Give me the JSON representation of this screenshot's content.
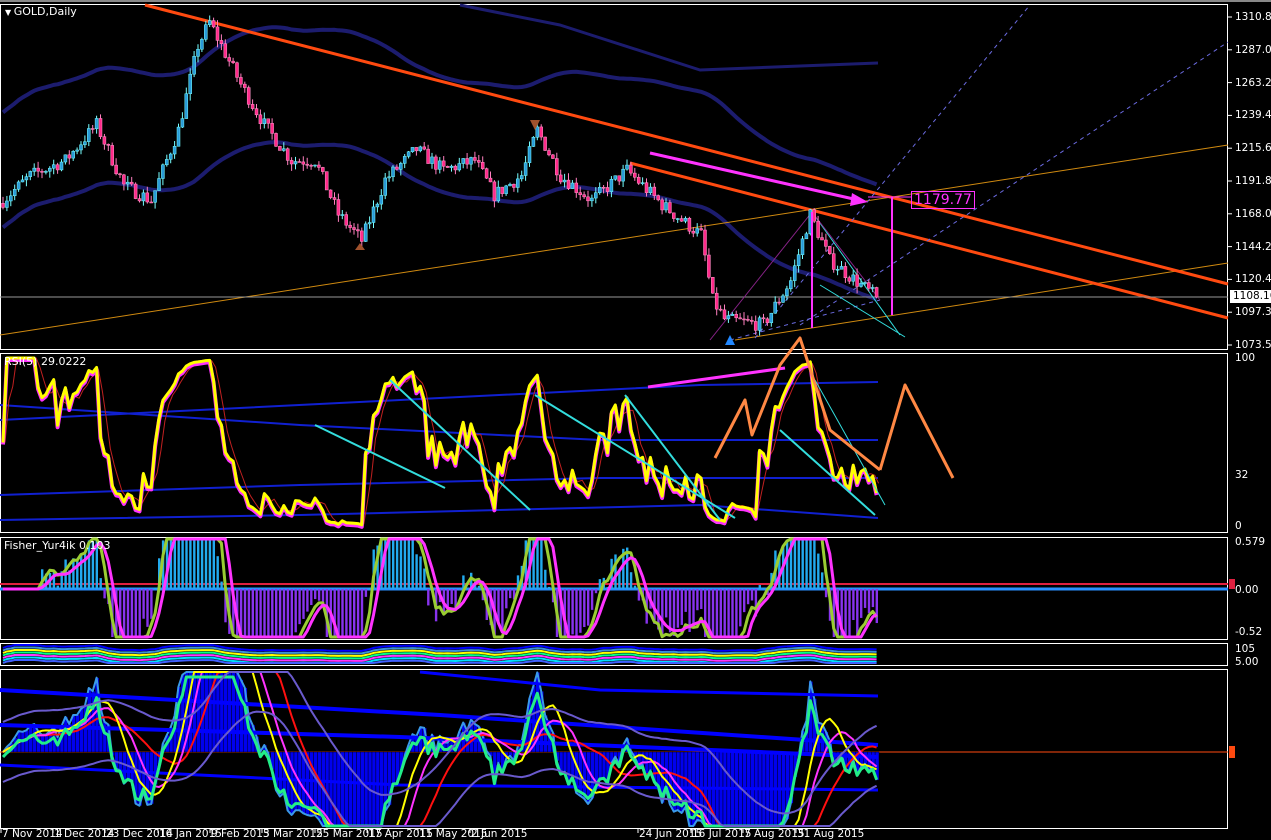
{
  "window": {
    "title": "GOLD,Daily"
  },
  "price_axis": [
    "1310.80",
    "1287.00",
    "1263.20",
    "1239.40",
    "1215.60",
    "1191.80",
    "1168.00",
    "1144.20",
    "1120.40",
    "1097.30",
    "1073.50"
  ],
  "current_price": "1108.16",
  "target_label": "1179.77",
  "rsi": {
    "label": "RSI(5) 29.0222",
    "axis": [
      "100",
      "32",
      "0"
    ]
  },
  "fisher": {
    "label": "Fisher_Yur4ik 0.103",
    "axis": [
      "0.579",
      "0.00",
      "-0.52"
    ]
  },
  "stoch": {
    "axis": [
      "105",
      "5.00"
    ]
  },
  "dates": [
    "7 Nov 2014",
    "1 Dec 2014",
    "23 Dec 2014",
    "16 Jan 2015",
    "9 Feb 2015",
    "3 Mar 2015",
    "25 Mar 2015",
    "17 Apr 2015",
    "11 May 2015",
    "2 Jun 2015",
    "24 Jun 2015",
    "16 Jul 2015",
    "7 Aug 2015",
    "31 Aug 2015"
  ],
  "colors": {
    "bull": "#2a9ad8",
    "bear": "#ff2a8a",
    "trend": "#ff4a10",
    "gold": "#d08a10",
    "ma": "#1c1c6e",
    "magenta": "#ff33ff",
    "rsi": "#ffff00",
    "cyan": "#33dddd"
  },
  "chart_data": {
    "type": "candlestick",
    "title": "GOLD,Daily",
    "ylim": [
      1073.5,
      1310.8
    ],
    "last_close": 1108.16,
    "price_anchors": [
      [
        0,
        1178
      ],
      [
        7,
        1196
      ],
      [
        16,
        1207
      ],
      [
        24,
        1233
      ],
      [
        31,
        1189
      ],
      [
        38,
        1178
      ],
      [
        45,
        1229
      ],
      [
        50,
        1290
      ],
      [
        53,
        1307
      ],
      [
        61,
        1262
      ],
      [
        67,
        1233
      ],
      [
        74,
        1207
      ],
      [
        80,
        1207
      ],
      [
        86,
        1168
      ],
      [
        92,
        1149
      ],
      [
        98,
        1193
      ],
      [
        106,
        1215
      ],
      [
        113,
        1200
      ],
      [
        121,
        1207
      ],
      [
        126,
        1182
      ],
      [
        133,
        1196
      ],
      [
        137,
        1229
      ],
      [
        143,
        1196
      ],
      [
        151,
        1178
      ],
      [
        160,
        1200
      ],
      [
        169,
        1175
      ],
      [
        179,
        1153
      ],
      [
        182,
        1106
      ],
      [
        185,
        1092
      ],
      [
        195,
        1088
      ],
      [
        202,
        1120
      ],
      [
        207,
        1168
      ],
      [
        212,
        1135
      ],
      [
        220,
        1117
      ],
      [
        224,
        1108
      ]
    ]
  }
}
